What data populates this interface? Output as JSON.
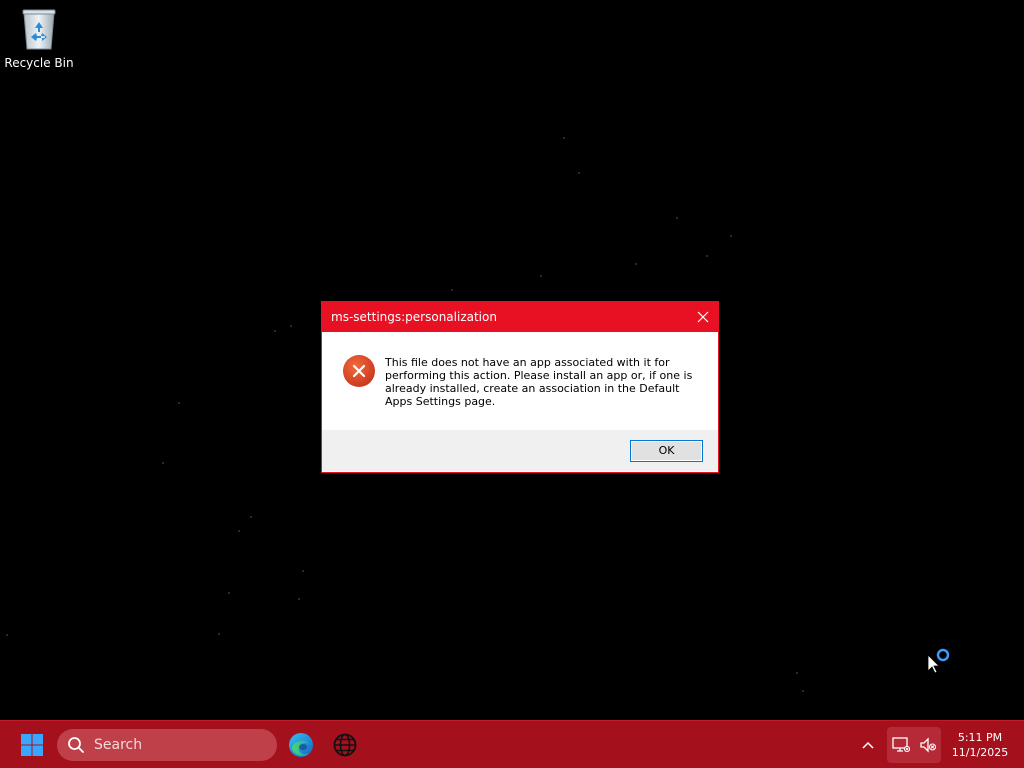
{
  "desktop": {
    "icons": [
      {
        "label": "Recycle Bin",
        "icon": "recycle-bin-icon"
      }
    ]
  },
  "dialog": {
    "title": "ms-settings:personalization",
    "icon": "error-icon",
    "message": "This file does not have an app associated with it for performing this action. Please install an app or, if one is already installed, create an association in the Default Apps Settings page.",
    "ok_label": "OK",
    "accent_color": "#e81123"
  },
  "taskbar": {
    "background_color": "#a5101d",
    "start_icon": "windows-start-icon",
    "search": {
      "placeholder": "Search",
      "icon": "search-icon"
    },
    "apps": [
      {
        "name": "Microsoft Edge",
        "icon": "edge-icon"
      },
      {
        "name": "Browser",
        "icon": "globe-icon"
      }
    ],
    "tray": {
      "chevron_icon": "chevron-up-icon",
      "network_icon": "network-disconnected-icon",
      "volume_icon": "volume-muted-icon"
    },
    "clock": {
      "time": "5:11 PM",
      "date": "11/1/2025"
    }
  }
}
